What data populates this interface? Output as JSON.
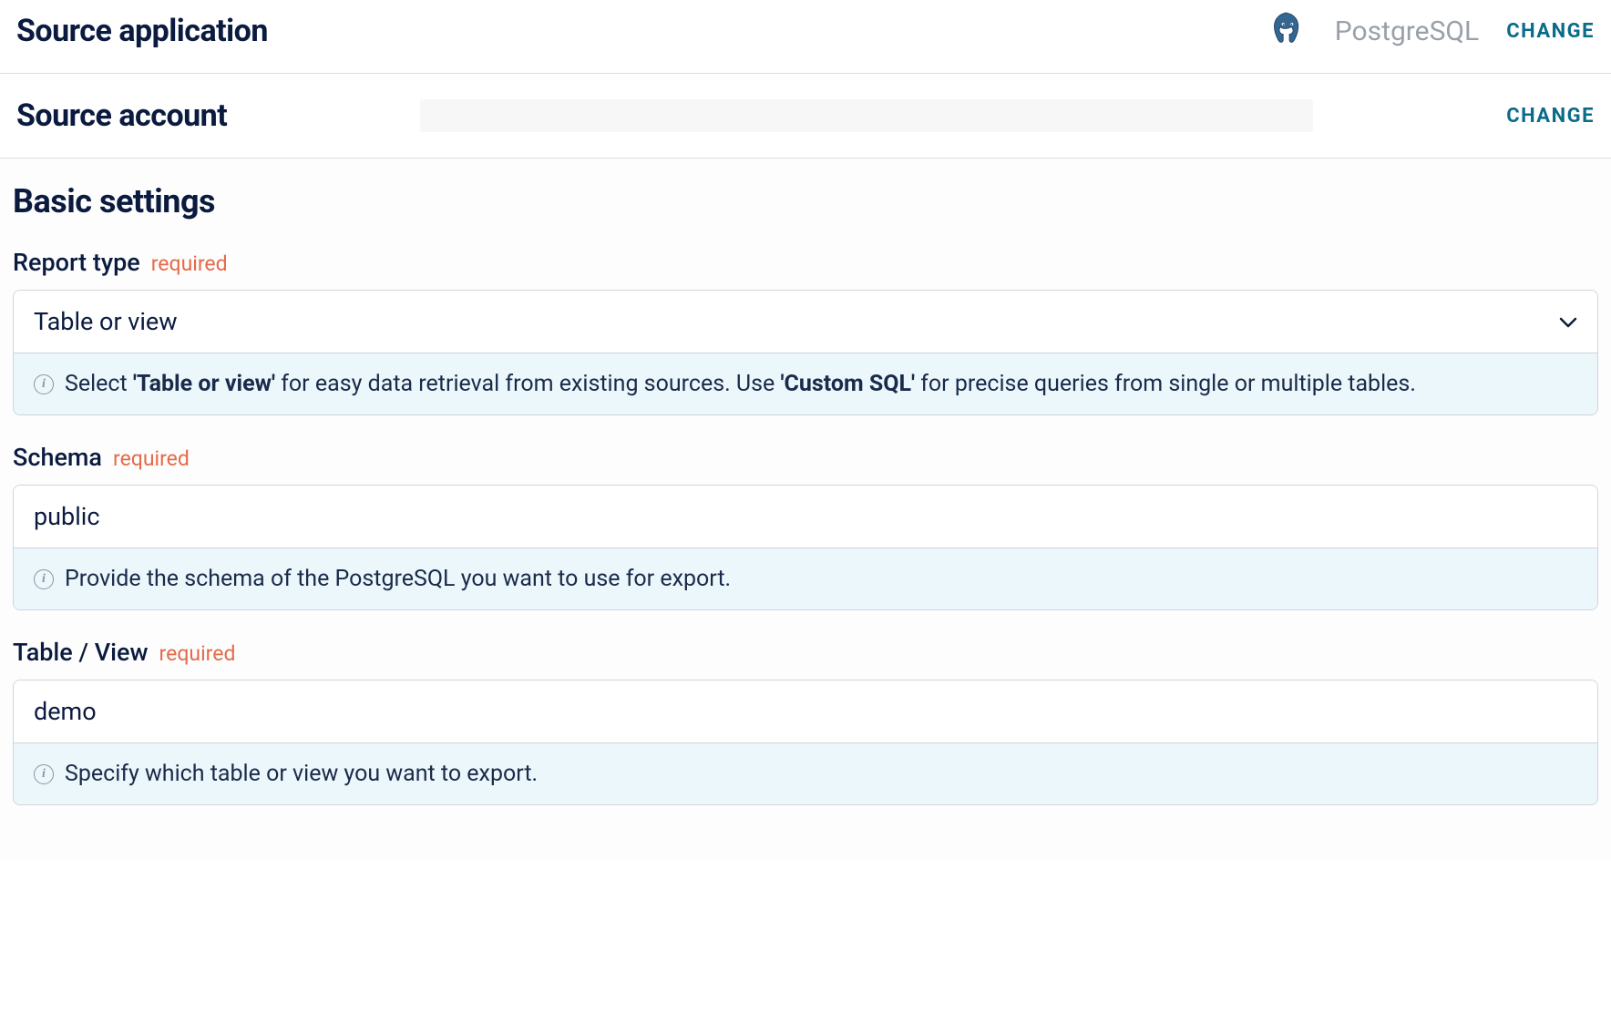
{
  "source_application": {
    "title": "Source application",
    "app_name": "PostgreSQL",
    "change_label": "CHANGE"
  },
  "source_account": {
    "title": "Source account",
    "change_label": "CHANGE"
  },
  "basic_settings": {
    "heading": "Basic settings",
    "fields": {
      "report_type": {
        "label": "Report type",
        "required_tag": "required",
        "value": "Table or view",
        "helper_prefix": "Select ",
        "helper_bold1": "'Table or view'",
        "helper_mid": " for easy data retrieval from existing sources. Use ",
        "helper_bold2": "'Custom SQL'",
        "helper_suffix": " for precise queries from single or multiple tables."
      },
      "schema": {
        "label": "Schema",
        "required_tag": "required",
        "value": "public",
        "helper": "Provide the schema of the PostgreSQL you want to use for export."
      },
      "table_view": {
        "label": "Table / View",
        "required_tag": "required",
        "value": "demo",
        "helper": "Specify which table or view you want to export."
      }
    }
  }
}
